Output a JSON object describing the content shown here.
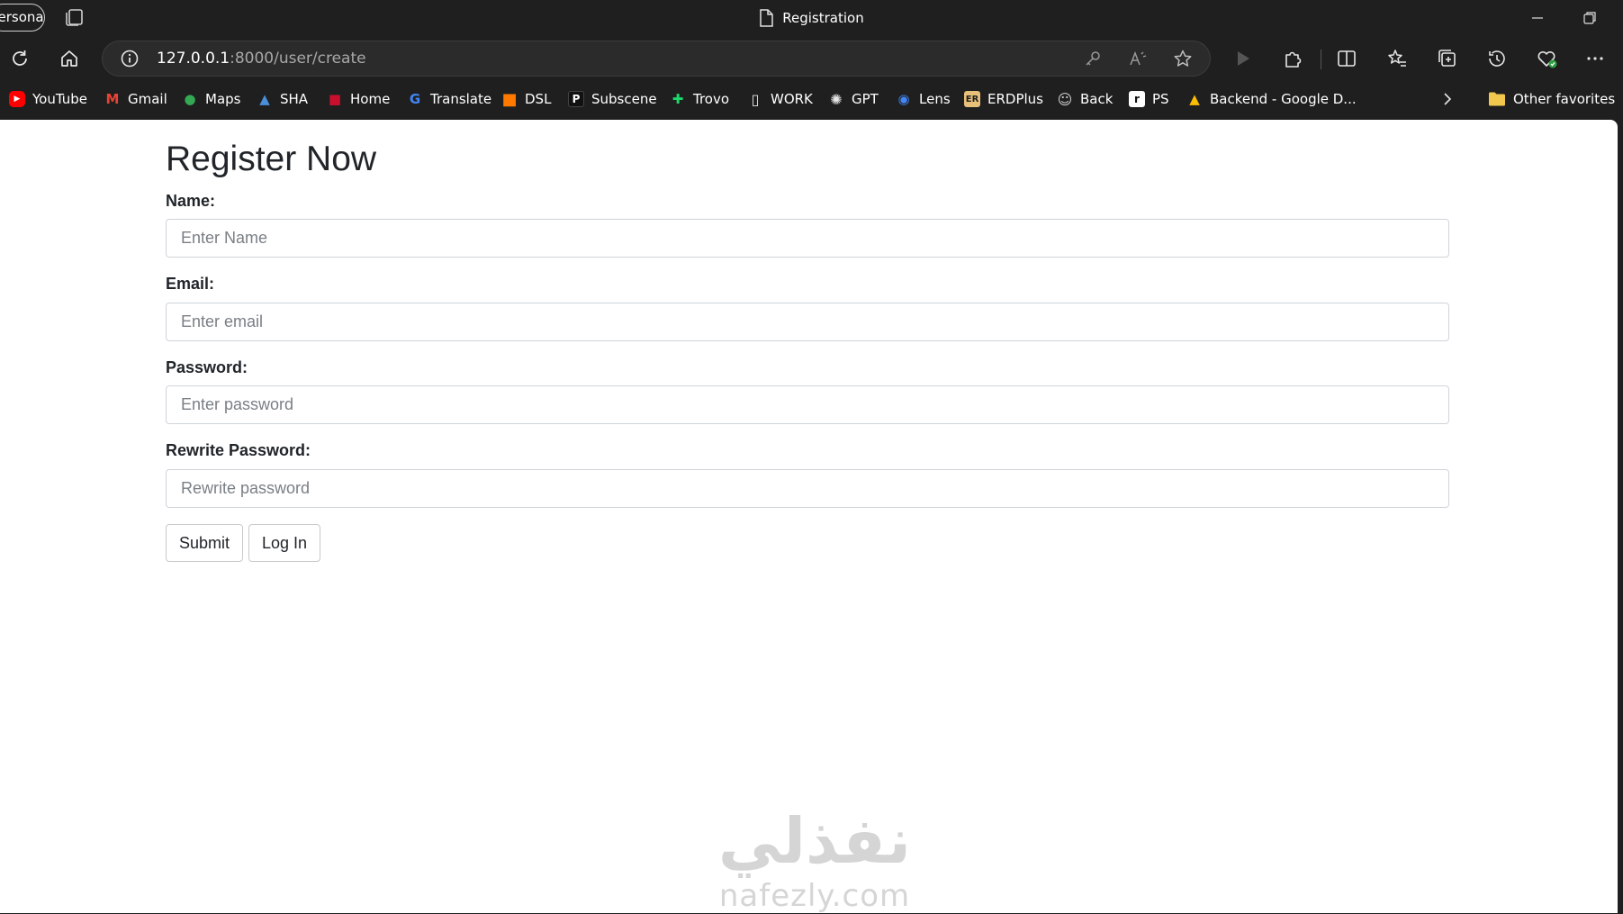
{
  "window": {
    "profile_label": "Personal",
    "title": "Registration"
  },
  "toolbar": {
    "url_host": "127.0.0.1",
    "url_rest": ":8000/user/create"
  },
  "favorites": [
    {
      "label": "YouTube",
      "icon": "youtube-icon",
      "color": "#ff0000"
    },
    {
      "label": "Gmail",
      "icon": "gmail-icon",
      "color": "#ea4335"
    },
    {
      "label": "Maps",
      "icon": "maps-icon",
      "color": "#34a853"
    },
    {
      "label": "SHA",
      "icon": "sha-icon",
      "color": "#4a90d9"
    },
    {
      "label": "Home",
      "icon": "home-flag-icon",
      "color": "#c8102e"
    },
    {
      "label": "Translate",
      "icon": "translate-icon",
      "color": "#4285f4"
    },
    {
      "label": "DSL",
      "icon": "dsl-icon",
      "color": "#ff7900"
    },
    {
      "label": "Subscene",
      "icon": "subscene-icon",
      "color": "#111111"
    },
    {
      "label": "Trovo",
      "icon": "trovo-icon",
      "color": "#1bd96a"
    },
    {
      "label": "WORK",
      "icon": "page-icon",
      "color": "#1f1f1f"
    },
    {
      "label": "GPT",
      "icon": "openai-icon",
      "color": "#1f1f1f"
    },
    {
      "label": "Lens",
      "icon": "lens-icon",
      "color": "#4285f4"
    },
    {
      "label": "ERDPlus",
      "icon": "erdplus-icon",
      "color": "#e8c07a"
    },
    {
      "label": "Back",
      "icon": "contact-icon",
      "color": "#cfcfcf"
    },
    {
      "label": "PS",
      "icon": "ps-icon",
      "color": "#ffffff"
    },
    {
      "label": "Backend - Google D...",
      "icon": "google-drive-icon",
      "color": "#fbbc04"
    }
  ],
  "other_favorites_label": "Other favorites",
  "form": {
    "title": "Register Now",
    "fields": [
      {
        "label": "Name:",
        "placeholder": "Enter Name",
        "type": "text"
      },
      {
        "label": "Email:",
        "placeholder": "Enter email",
        "type": "email"
      },
      {
        "label": "Password:",
        "placeholder": "Enter password",
        "type": "password"
      },
      {
        "label": "Rewrite Password:",
        "placeholder": "Rewrite password",
        "type": "password"
      }
    ],
    "submit_label": "Submit",
    "login_label": "Log In"
  },
  "watermark": {
    "arabic": "نفذلي",
    "latin": "nafezly.com"
  }
}
